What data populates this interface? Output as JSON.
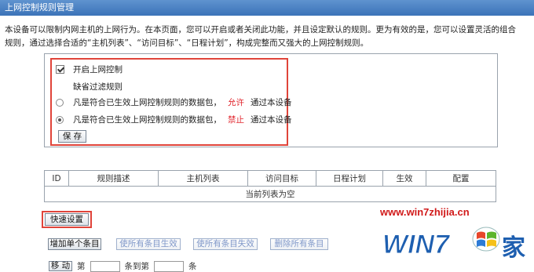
{
  "title": "上网控制规则管理",
  "intro_text": "本设备可以限制内网主机的上网行为。在本页面，您可以开启或者关闭此功能，并且设定默认的规则。更为有效的是，您可以设置灵活的组合规则，通过选择合适的“主机列表”、“访问目标”、“日程计划”，构成完整而又强大的上网控制规则。",
  "control": {
    "enable_label": "开启上网控制",
    "default_rule_label": "缺省过滤规则",
    "rule_prefix": "凡是符合已生效上网控制规则的数据包，",
    "allow_word": "允许",
    "deny_word": "禁止",
    "rule_suffix": "通过本设备",
    "save_label": "保 存"
  },
  "table": {
    "headers": [
      "ID",
      "规则描述",
      "主机列表",
      "访问目标",
      "日程计划",
      "生效",
      "配置"
    ],
    "empty_text": "当前列表为空"
  },
  "buttons": {
    "quick_setup": "快速设置",
    "add_single": "增加单个条目",
    "enable_all": "使所有条目生效",
    "disable_all": "使所有条目失效",
    "delete_all": "删除所有条目"
  },
  "pager": {
    "move": "移 动",
    "item_word": "第",
    "to_word": "条到第",
    "end_word": "条"
  },
  "watermark": {
    "url": "www.win7zhijia.cn",
    "logo_text": "WIN7",
    "logo_suffix": "家"
  }
}
